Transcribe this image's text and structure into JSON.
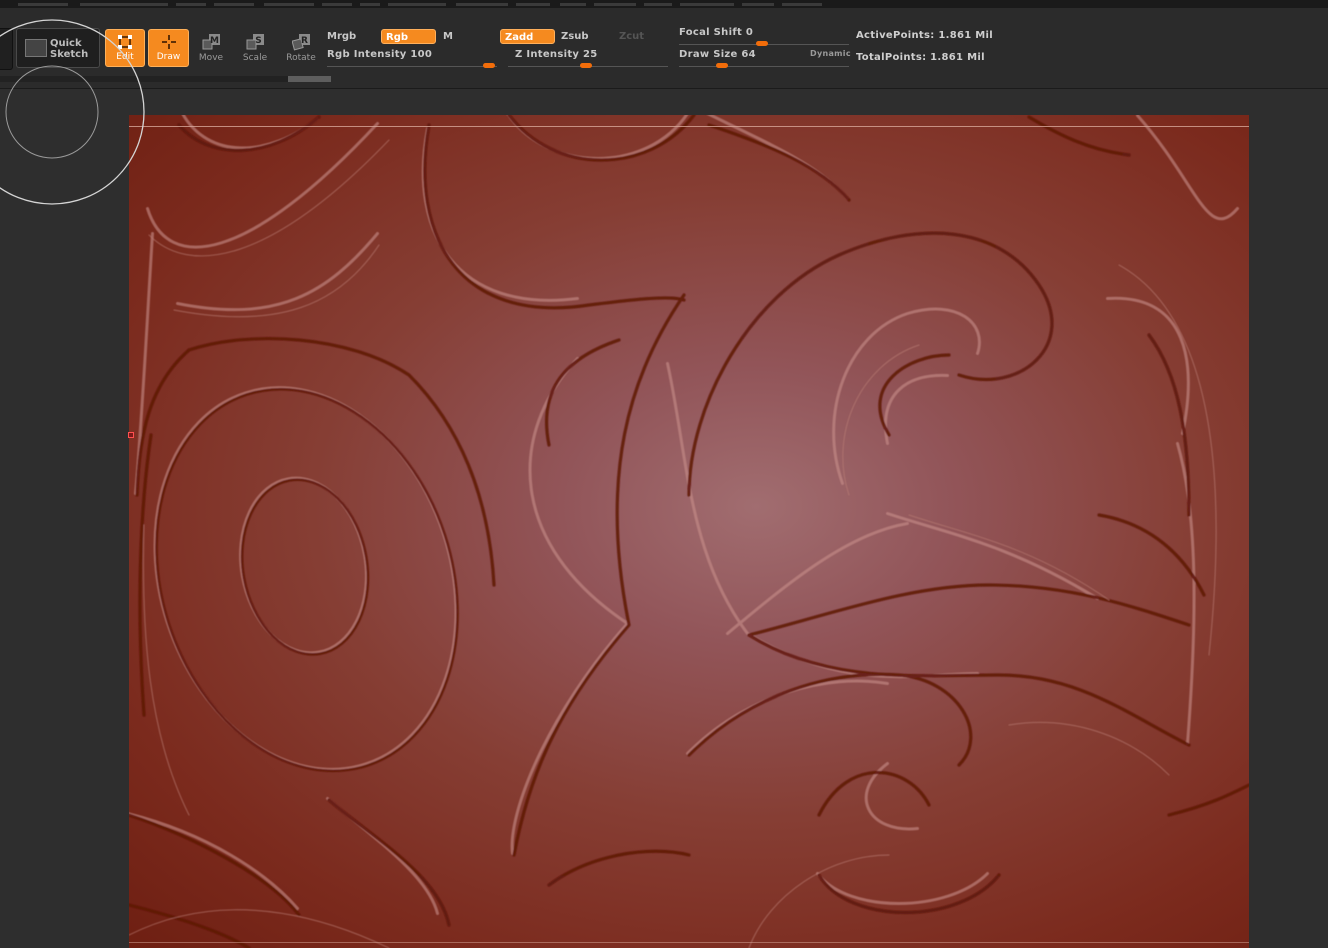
{
  "toolbar": {
    "quick_sketch_label": "Quick Sketch",
    "edit_label": "Edit",
    "draw_label": "Draw",
    "move_label": "Move",
    "scale_label": "Scale",
    "rotate_label": "Rotate",
    "move_icon_letter": "M",
    "scale_icon_letter": "S",
    "rotate_icon_letter": "R"
  },
  "material": {
    "mrgb_label": "Mrgb",
    "rgb_label": "Rgb",
    "m_label": "M",
    "rgb_intensity_label": "Rgb Intensity 100",
    "rgb_intensity_value": 100
  },
  "sculpt": {
    "zadd_label": "Zadd",
    "zsub_label": "Zsub",
    "zcut_label": "Zcut",
    "z_intensity_label": "Z Intensity 25",
    "z_intensity_value": 25
  },
  "brush": {
    "focal_shift_label": "Focal Shift 0",
    "focal_shift_value": 0,
    "draw_size_label": "Draw Size 64",
    "draw_size_value": 64,
    "dynamic_label": "Dynamic"
  },
  "stats": {
    "active_points": "ActivePoints: 1.861 Mil",
    "total_points": "TotalPoints: 1.861 Mil"
  },
  "colors": {
    "accent": "#f58a1f",
    "slider_knob": "#f26d0a",
    "background": "#262626",
    "clay": "#8a3e34",
    "groove": "#5e1408",
    "highlight": "#c98f8a"
  }
}
